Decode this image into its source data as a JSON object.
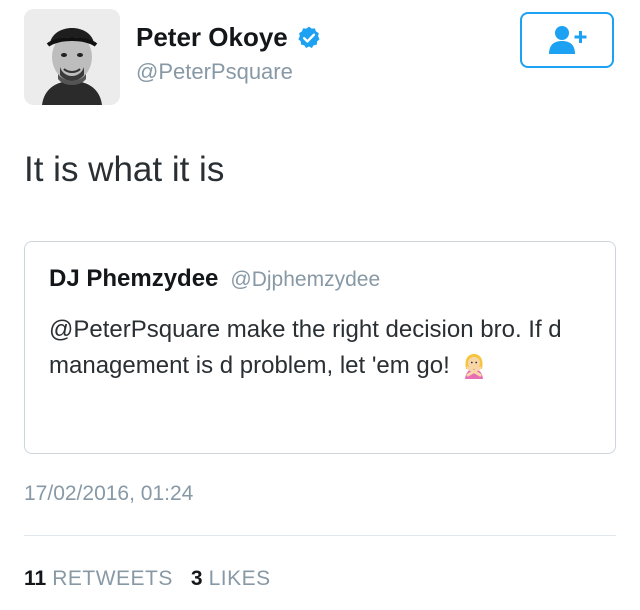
{
  "author": {
    "name": "Peter Okoye",
    "handle": "@PeterPsquare",
    "verified": true,
    "avatar_icon": "profile-photo"
  },
  "follow_button": {
    "icon": "add-user-icon",
    "color": "#1da1f2"
  },
  "tweet": {
    "text": "It is what it is"
  },
  "quoted_tweet": {
    "name": "DJ Phemzydee",
    "handle": "@Djphemzydee",
    "text": "@PeterPsquare make the right decision bro. If d management is d problem, let 'em go!",
    "emoji": "person-gesturing-no-emoji"
  },
  "timestamp": "17/02/2016, 01:24",
  "stats": {
    "retweets_count": "11",
    "retweets_label": "RETWEETS",
    "likes_count": "3",
    "likes_label": "LIKES"
  },
  "colors": {
    "accent": "#1da1f2",
    "text": "#292f33",
    "muted": "#8899a6",
    "border": "#cdd6dd"
  }
}
